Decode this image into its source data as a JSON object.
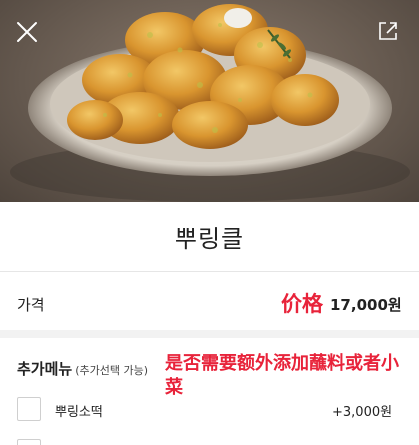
{
  "header": {
    "close_icon": "close-icon",
    "share_icon": "share-icon",
    "image_subject": "fried-chicken-photo"
  },
  "product": {
    "name": "뿌링클"
  },
  "price": {
    "label": "가격",
    "annotation": "价格",
    "value": "17,000원"
  },
  "addons": {
    "title": "추가메뉴",
    "subtitle": "(추가선택 가능)",
    "annotation": "是否需要额外添加蘸料或者小菜",
    "options": [
      {
        "name": "뿌링소떡",
        "price": "+3,000원",
        "checked": false
      }
    ]
  },
  "colors": {
    "accent_red": "#e8233a",
    "divider": "#e6e6e6"
  }
}
